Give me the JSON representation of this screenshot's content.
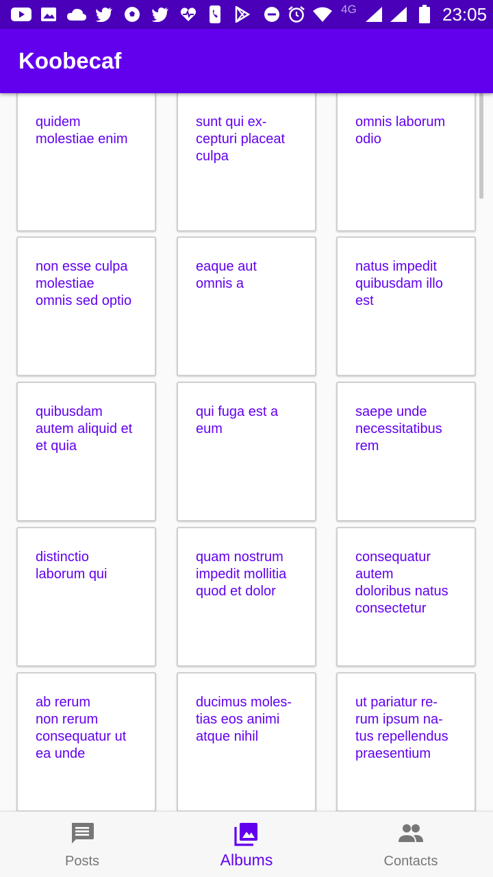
{
  "status_bar": {
    "time": "23:05",
    "network": "4G",
    "icons": [
      "youtube-icon",
      "gallery-icon",
      "cloud-icon",
      "twitter-icon",
      "soccer-icon",
      "twitter-icon",
      "health-icon",
      "phone-icon",
      "play-store-icon",
      "do-not-disturb-icon",
      "alarm-icon",
      "wifi-icon",
      "signal-icon",
      "signal-icon",
      "battery-icon"
    ]
  },
  "app_bar": {
    "title": "Koobecaf"
  },
  "albums": [
    {
      "title": "quidem\nmolestiae enim"
    },
    {
      "title": "sunt qui ex-\ncepturi placeat\nculpa"
    },
    {
      "title": "omnis laborum\nodio"
    },
    {
      "title": "non esse culpa\nmolestiae\nomnis sed optio"
    },
    {
      "title": "eaque aut\nomnis a"
    },
    {
      "title": "natus impedit\nquibusdam illo\nest"
    },
    {
      "title": "quibusdam\nautem aliquid et\net quia"
    },
    {
      "title": "qui fuga est a\neum"
    },
    {
      "title": "saepe unde\nnecessitatibus\nrem"
    },
    {
      "title": "distinctio\nlaborum qui"
    },
    {
      "title": "quam nostrum\nimpedit mollitia\nquod et dolor"
    },
    {
      "title": "consequatur\nautem\ndoloribus natus\nconsectetur"
    },
    {
      "title": "ab rerum\nnon rerum\nconsequatur ut\nea unde"
    },
    {
      "title": "ducimus moles-\ntias eos animi\natque nihil"
    },
    {
      "title": "ut pariatur re-\nrum ipsum na-\ntus repellendus\npraesentium"
    }
  ],
  "bottom_nav": {
    "items": [
      {
        "label": "Posts",
        "icon": "chat-icon"
      },
      {
        "label": "Albums",
        "icon": "photo-library-icon"
      },
      {
        "label": "Contacts",
        "icon": "people-icon"
      }
    ],
    "active": "Albums"
  },
  "colors": {
    "primary": "#6200ee",
    "status_bar": "#4a00b8",
    "inactive": "#777777"
  }
}
